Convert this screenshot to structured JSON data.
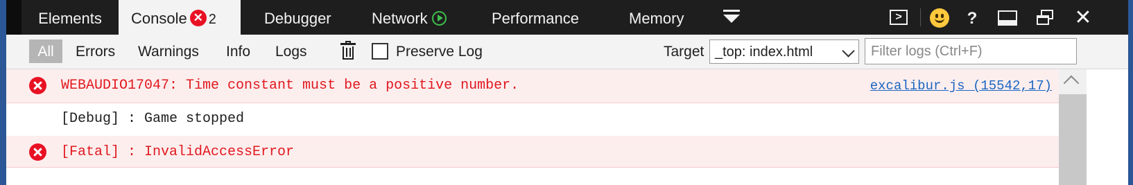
{
  "tabs": [
    {
      "label": "Elements"
    },
    {
      "label": "Console",
      "error_count": "2"
    },
    {
      "label": "Debugger"
    },
    {
      "label": "Network"
    },
    {
      "label": "Performance"
    },
    {
      "label": "Memory"
    }
  ],
  "toolbar_icons": {
    "error_badge_glyph": "✕",
    "help_glyph": "?",
    "close_glyph": "✕",
    "console_glyph": ">"
  },
  "filters": {
    "all": "All",
    "errors": "Errors",
    "warnings": "Warnings",
    "info": "Info",
    "logs": "Logs",
    "preserve_log": "Preserve Log",
    "target_label": "Target",
    "target_value": "_top: index.html",
    "filter_placeholder": "Filter logs (Ctrl+F)",
    "filter_value": ""
  },
  "messages": [
    {
      "level": "error",
      "text": "WEBAUDIO17047: Time constant must be a positive number.",
      "source": "excalibur.js (15542,17)"
    },
    {
      "level": "debug",
      "text": "[Debug] :  Game stopped"
    },
    {
      "level": "error",
      "text": "[Fatal] :  InvalidAccessError"
    }
  ],
  "colors": {
    "tab_bar_bg": "#1e1e1e",
    "active_tab_bg": "#f3f3f3",
    "error_red": "#e81123",
    "error_row_bg": "#fdeeee",
    "link_blue": "#1a66c2",
    "network_play_green": "#3fbf4c",
    "smiley_yellow": "#ffc83d",
    "window_frame_blue": "#2b5797"
  }
}
